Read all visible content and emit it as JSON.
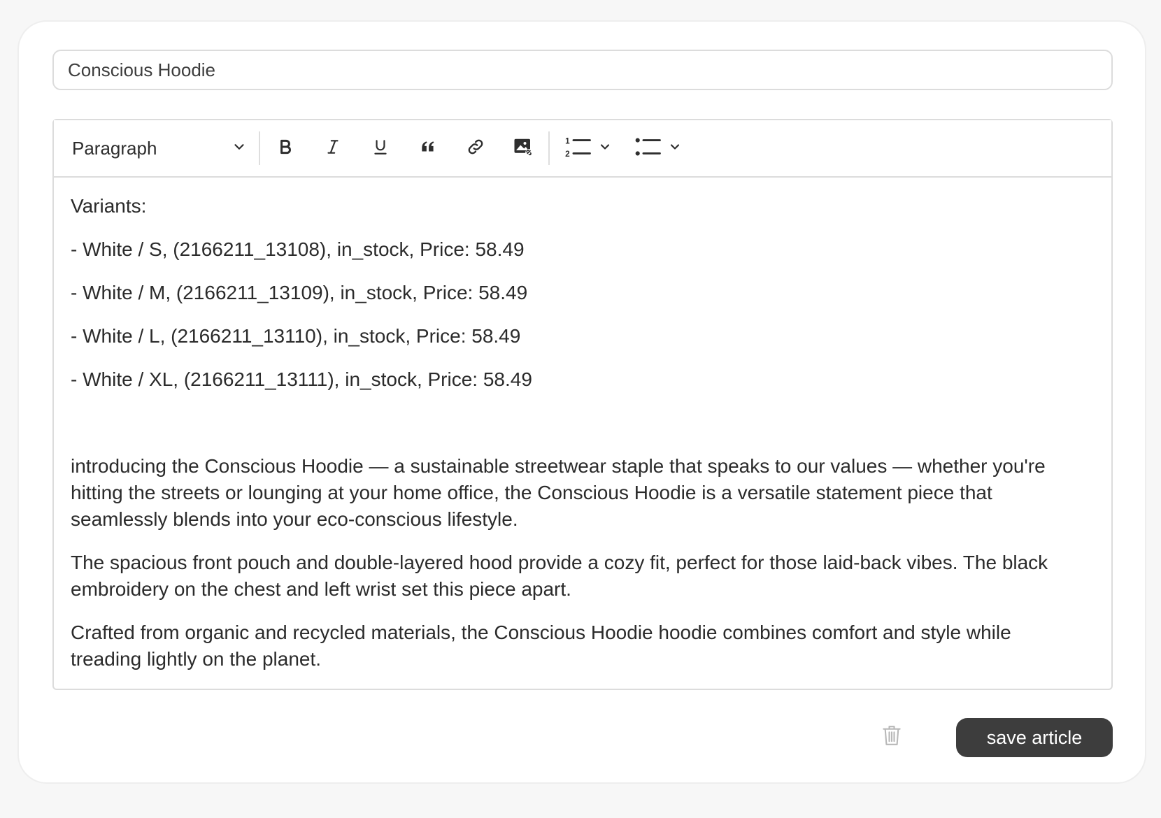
{
  "article": {
    "title_value": "Conscious Hoodie"
  },
  "toolbar": {
    "block_type": "Paragraph",
    "buttons": [
      "bold-icon",
      "italic-icon",
      "underline-icon",
      "quote-icon",
      "link-icon",
      "image-icon",
      "ordered-list-icon",
      "bullet-list-icon"
    ]
  },
  "content": {
    "variants_heading": "Variants:",
    "variants": [
      "- White / S, (2166211_13108), in_stock, Price: 58.49",
      "- White / M, (2166211_13109), in_stock, Price: 58.49",
      "- White / L, (2166211_13110), in_stock, Price: 58.49",
      "- White / XL, (2166211_13111), in_stock, Price: 58.49"
    ],
    "paragraphs": [
      "introducing the Conscious Hoodie — a sustainable streetwear staple that speaks to our values — whether you're hitting the streets or lounging at your home office, the Conscious Hoodie is a versatile statement piece that seamlessly blends into your eco-conscious lifestyle.",
      "The spacious front pouch and double-layered hood provide a cozy fit, perfect for those laid-back vibes. The black embroidery on the chest and left wrist set this piece apart.",
      "Crafted from organic and recycled materials, the Conscious Hoodie hoodie combines comfort and style while treading lightly on the planet."
    ]
  },
  "actions": {
    "save_label": "save article",
    "delete_icon": "trash-icon"
  },
  "colors": {
    "primary_button": "#3d3d3d",
    "border": "#dcdcdc",
    "page_bg": "#f7f7f7"
  }
}
